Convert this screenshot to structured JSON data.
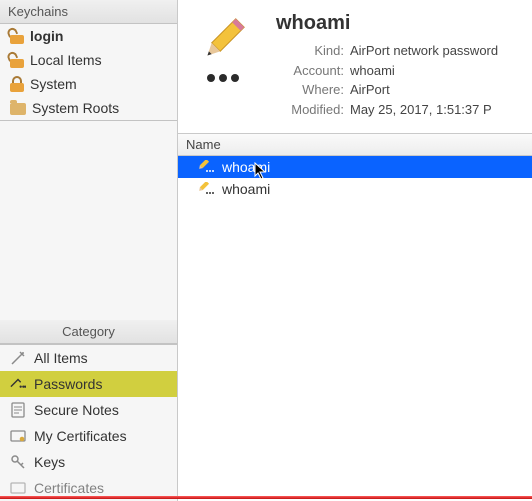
{
  "sidebar": {
    "keychains_header": "Keychains",
    "keychains": [
      {
        "label": "login",
        "icon": "lock-open",
        "bold": true
      },
      {
        "label": "Local Items",
        "icon": "lock-open",
        "bold": false
      },
      {
        "label": "System",
        "icon": "lock",
        "bold": false
      },
      {
        "label": "System Roots",
        "icon": "folder",
        "bold": false
      }
    ],
    "category_header": "Category",
    "categories": [
      {
        "label": "All Items",
        "icon": "wand",
        "selected": false
      },
      {
        "label": "Passwords",
        "icon": "key-dots",
        "selected": true
      },
      {
        "label": "Secure Notes",
        "icon": "note",
        "selected": false
      },
      {
        "label": "My Certificates",
        "icon": "badge",
        "selected": false
      },
      {
        "label": "Keys",
        "icon": "key",
        "selected": false
      },
      {
        "label": "Certificates",
        "icon": "cert",
        "selected": false
      }
    ]
  },
  "detail": {
    "title": "whoami",
    "rows": [
      {
        "label": "Kind:",
        "value": "AirPort network password"
      },
      {
        "label": "Account:",
        "value": "whoami"
      },
      {
        "label": "Where:",
        "value": "AirPort"
      },
      {
        "label": "Modified:",
        "value": "May 25, 2017, 1:51:37 P"
      }
    ]
  },
  "list": {
    "column": "Name",
    "items": [
      {
        "name": "whoami",
        "selected": true
      },
      {
        "name": "whoami",
        "selected": false
      }
    ]
  },
  "colors": {
    "selection_row": "#0a63ff",
    "category_sel": "#d1cf3f"
  }
}
